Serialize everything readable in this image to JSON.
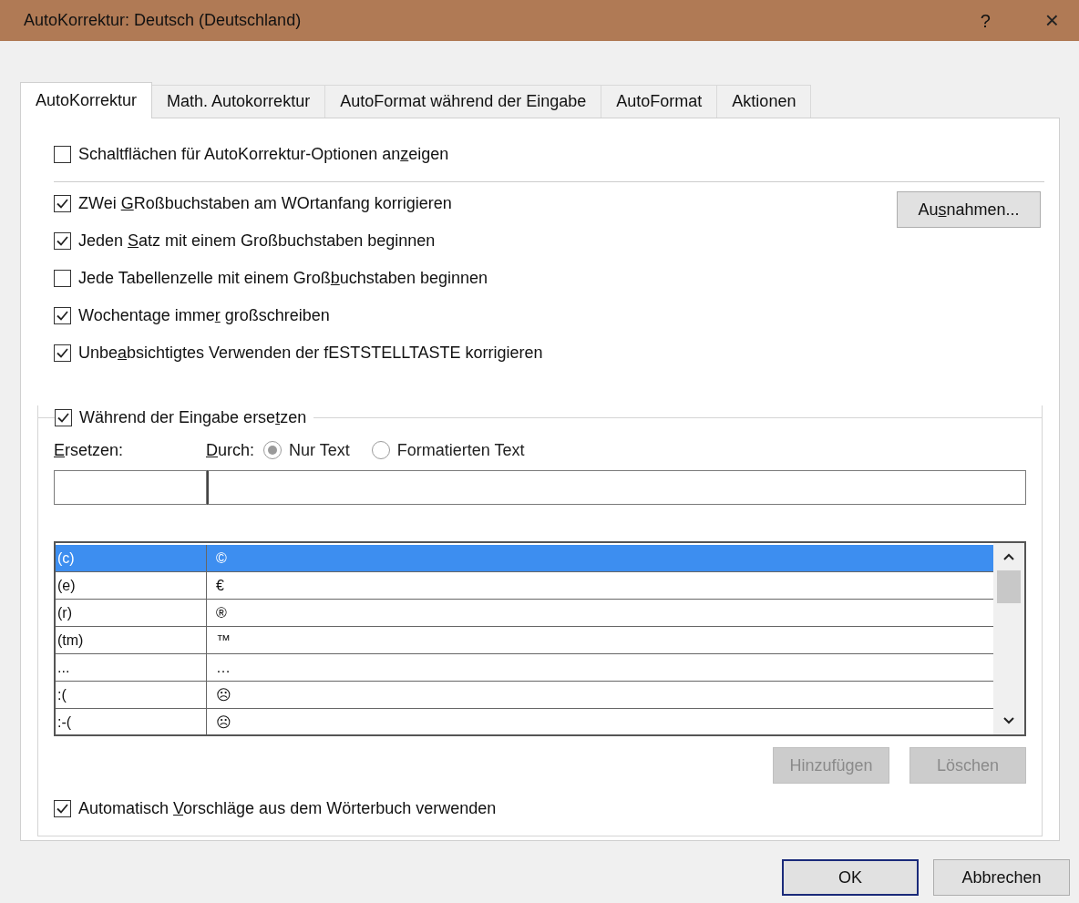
{
  "window": {
    "title": "AutoKorrektur: Deutsch (Deutschland)",
    "help": "?",
    "close": "×"
  },
  "tabs": [
    {
      "label": "AutoKorrektur",
      "selected": true
    },
    {
      "label": "Math. Autokorrektur",
      "selected": false
    },
    {
      "label": "AutoFormat während der Eingabe",
      "selected": false
    },
    {
      "label": "AutoFormat",
      "selected": false
    },
    {
      "label": "Aktionen",
      "selected": false
    }
  ],
  "show_buttons_option": {
    "before": "Schaltflächen für AutoKorrektur-Optionen an",
    "key": "z",
    "after": "eigen",
    "checked": false
  },
  "options": [
    {
      "before": "ZWei ",
      "key": "G",
      "after": "Roßbuchstaben am WOrtanfang korrigieren",
      "checked": true
    },
    {
      "before": "Jeden ",
      "key": "S",
      "after": "atz mit einem Großbuchstaben beginnen",
      "checked": true
    },
    {
      "before": "Jede Tabellenzelle mit einem Groß",
      "key": "b",
      "after": "uchstaben beginnen",
      "checked": false
    },
    {
      "before": "Wochentage imme",
      "key": "r",
      "after": " großschreiben",
      "checked": true
    },
    {
      "before": "Unbe",
      "key": "a",
      "after": "bsichtigtes Verwenden der fESTSTELLTASTE korrigieren",
      "checked": true
    }
  ],
  "exceptions_button": {
    "before": "Au",
    "key": "s",
    "after": "nahmen..."
  },
  "replace_group": {
    "before": "Während der Eingabe erse",
    "key": "t",
    "after": "zen",
    "checked": true
  },
  "replace_label": {
    "key": "E",
    "after": "rsetzen:"
  },
  "with_label": {
    "key": "D",
    "after": "urch:"
  },
  "radios": [
    {
      "label": "Nur Text",
      "selected": true
    },
    {
      "label": "Formatierten Text",
      "selected": false
    }
  ],
  "entries": [
    {
      "replace": "(c)",
      "with": "©",
      "selected": true
    },
    {
      "replace": "(e)",
      "with": "€",
      "selected": false
    },
    {
      "replace": "(r)",
      "with": "®",
      "selected": false
    },
    {
      "replace": "(tm)",
      "with": "™",
      "selected": false
    },
    {
      "replace": "...",
      "with": "…",
      "selected": false
    },
    {
      "replace": ":(",
      "with": "☹",
      "selected": false
    },
    {
      "replace": ":-(",
      "with": "☹",
      "selected": false
    }
  ],
  "list_buttons": [
    {
      "label": "Hinzufügen",
      "disabled": true
    },
    {
      "label": "Löschen",
      "disabled": true
    }
  ],
  "dictionary_option": {
    "before": "Automatisch ",
    "key": "V",
    "after": "orschläge aus dem Wörterbuch verwenden",
    "checked": true
  },
  "buttons": [
    {
      "label": "OK",
      "default": true
    },
    {
      "label": "Abbrechen",
      "default": false
    }
  ]
}
